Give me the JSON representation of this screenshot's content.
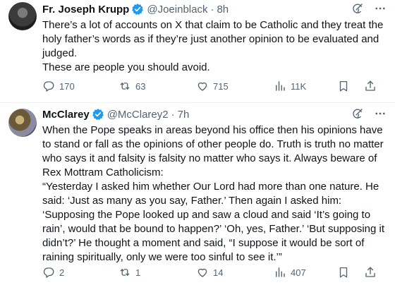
{
  "tweets": [
    {
      "name": "Fr. Joseph Krupp",
      "handle": "@Joeinblack",
      "time": "8h",
      "paragraphs": [
        "There’s a lot of accounts on X that claim to be Catholic and they treat the holy father’s words as if they’re just another opinion to be evaluated and judged.",
        "These are people you should avoid."
      ],
      "replies": "170",
      "reposts": "63",
      "likes": "715",
      "views": "11K"
    },
    {
      "name": "McClarey",
      "handle": "@McClarey2",
      "time": "7h",
      "paragraphs": [
        "When the Pope speaks in areas beyond his office then his opinions have to stand or fall as the opinions of other people do.  Truth is truth no matter who says it and falsity is falsity no matter who says it.  Always beware of Rex Mottram Catholicism:",
        "“Yesterday I asked him whether Our Lord had more than one nature. He said: ‘Just as many as you say, Father.’ Then again I asked him:  ‘Supposing the Pope looked up and saw a cloud and said ‘It’s going to  rain’, would that be bound to happen?’ ‘Oh, yes, Father.’ ‘But supposing  it didn’t?’ He thought a moment and said, “I suppose it would be sort  of raining spiritually, only we were too sinful to see it.’”"
      ],
      "replies": "2",
      "reposts": "1",
      "likes": "14",
      "views": "407"
    }
  ],
  "icons": {
    "verified": "verified-badge-icon",
    "grok": "grok-icon",
    "more": "more-icon",
    "reply": "reply-icon",
    "repost": "repost-icon",
    "like": "like-icon",
    "views": "views-icon",
    "bookmark": "bookmark-icon",
    "share": "share-icon"
  },
  "colors": {
    "verified": "#1d9bf0",
    "secondary": "#536471",
    "text": "#0f1419"
  }
}
